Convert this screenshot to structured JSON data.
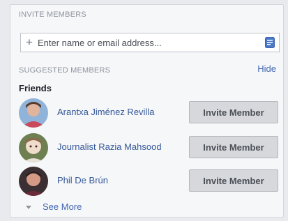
{
  "invite_section": {
    "title": "INVITE MEMBERS",
    "input_placeholder": "Enter name or email address...",
    "icons": {
      "add": "plus-icon",
      "contacts": "notebook-icon"
    }
  },
  "suggested_section": {
    "title": "SUGGESTED MEMBERS",
    "hide_label": "Hide",
    "group_label": "Friends",
    "members": [
      {
        "name": "Arantxa Jiménez Revilla",
        "button_label": "Invite Member"
      },
      {
        "name": "Journalist Razia Mahsood",
        "button_label": "Invite Member"
      },
      {
        "name": "Phil De Brún",
        "button_label": "Invite Member"
      }
    ],
    "see_more_label": "See More"
  },
  "colors": {
    "link": "#4267b2",
    "button_bg": "#d6d8dc",
    "panel_bg": "#f6f7f9"
  }
}
